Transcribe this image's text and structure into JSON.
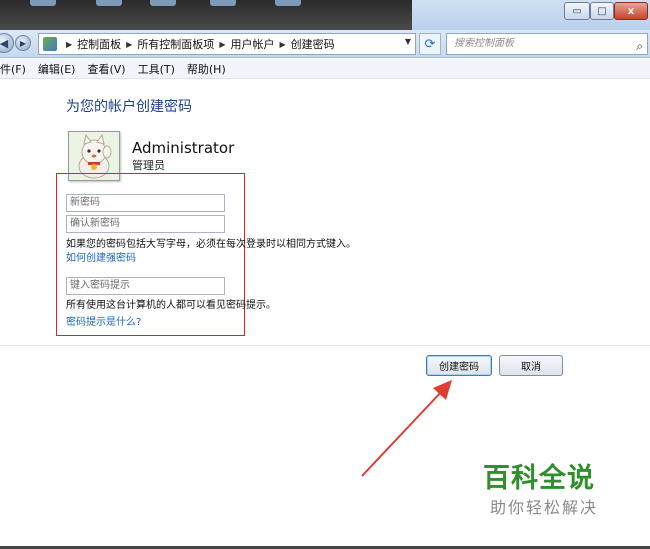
{
  "window": {
    "minimize_symbol": "▭",
    "maximize_symbol": "□",
    "close_symbol": "x"
  },
  "address": {
    "back_symbol": "◀",
    "forward_symbol": "▶",
    "crumbs": [
      "控制面板",
      "所有控制面板项",
      "用户帐户",
      "创建密码"
    ],
    "search_placeholder": "搜索控制面板",
    "refresh_symbol": "⟳",
    "search_symbol": "⌕"
  },
  "menu": [
    "件(F)",
    "编辑(E)",
    "查看(V)",
    "工具(T)",
    "帮助(H)"
  ],
  "content": {
    "title": "为您的帐户创建密码",
    "user_name": "Administrator",
    "user_role": "管理员",
    "new_password_placeholder": "新密码",
    "confirm_password_placeholder": "确认新密码",
    "case_note": "如果您的密码包括大写字母，必须在每次登录时以相同方式键入。",
    "strong_link": "如何创建强密码",
    "hint_placeholder": "键入密码提示",
    "hint_note": "所有使用这台计算机的人都可以看见密码提示。",
    "hint_link": "密码提示是什么?"
  },
  "buttons": {
    "create": "创建密码",
    "cancel": "取消"
  },
  "watermark": {
    "title": "百科全说",
    "subtitle": "助你轻松解决"
  },
  "colors": {
    "highlight_frame": "#d6262b",
    "arrow": "#e03c2f",
    "link": "#1e64c8",
    "watermark": "#2e8f2b"
  }
}
